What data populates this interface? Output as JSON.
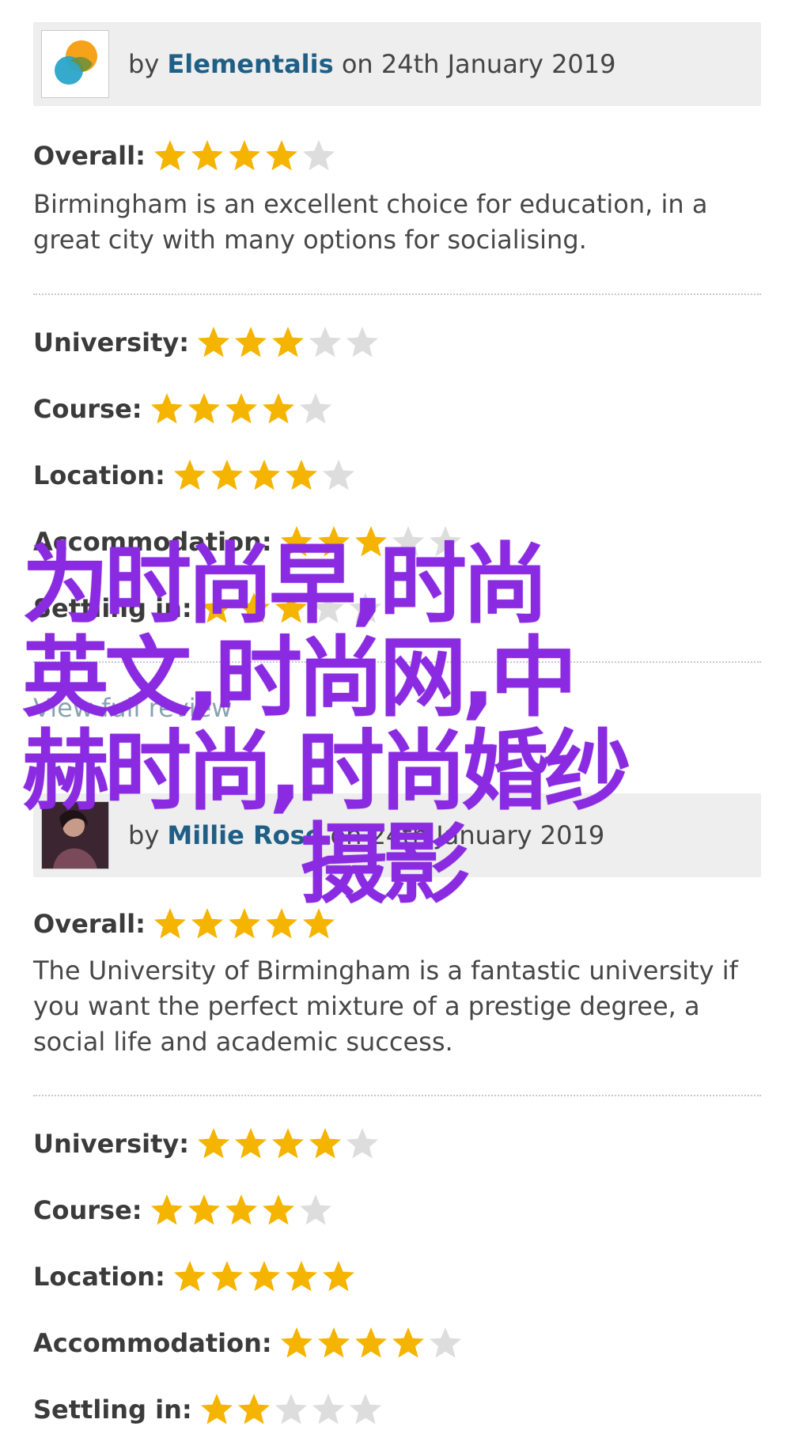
{
  "reviews": [
    {
      "by": "by",
      "author": "Elementalis",
      "on_date": "on 24th January 2019",
      "avatar_icon": "avatar-logo-icon",
      "overall_label": "Overall:",
      "overall_stars": 4,
      "comment": "Birmingham is an excellent choice for education, in a great city with many options for socialising.",
      "ratings": [
        {
          "label": "University:",
          "stars": 3
        },
        {
          "label": "Course:",
          "stars": 4
        },
        {
          "label": "Location:",
          "stars": 4
        },
        {
          "label": "Accommodation:",
          "stars": 3
        },
        {
          "label": "Settling in:",
          "stars": 3
        }
      ],
      "view_full": "View full review"
    },
    {
      "by": "by",
      "author": "Millie Rose",
      "on_date": "on 24th January 2019",
      "avatar_icon": "avatar-photo-icon",
      "overall_label": "Overall:",
      "overall_stars": 5,
      "comment": "The University of Birmingham is a fantastic university if you want the perfect mixture of a prestige degree, a social life and academic success.",
      "ratings": [
        {
          "label": "University:",
          "stars": 4
        },
        {
          "label": "Course:",
          "stars": 4
        },
        {
          "label": "Location:",
          "stars": 5
        },
        {
          "label": "Accommodation:",
          "stars": 4
        },
        {
          "label": "Settling in:",
          "stars": 2
        }
      ]
    }
  ],
  "star_max": 5,
  "colors": {
    "star_filled": "#f5b400",
    "star_empty": "#dddddd",
    "author_link": "#1f5f86",
    "header_bg": "#eeeeee",
    "watermark": "#8a2be2"
  },
  "watermark": {
    "line1": "为时尚早,时尚",
    "line2": "英文,时尚网,中",
    "line3": "赫时尚,时尚婚纱",
    "line4": "摄影"
  }
}
